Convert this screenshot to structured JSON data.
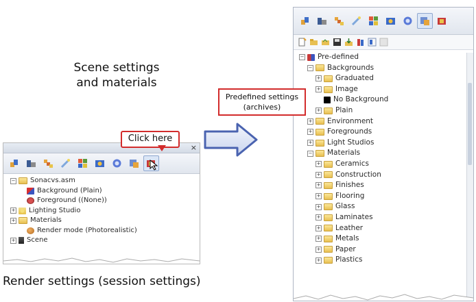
{
  "captions": {
    "scene": [
      "Scene settings",
      "and materials"
    ],
    "render": "Render settings (session settings)"
  },
  "callouts": {
    "click_here": "Click here",
    "predefined": [
      "Predefined settings",
      "(archives)"
    ]
  },
  "left_panel": {
    "close_label": "×",
    "tree": [
      {
        "label": "Sonacvs.asm",
        "level": 0,
        "expander": "−",
        "icon": "folder-icon"
      },
      {
        "label": "Background (Plain)",
        "level": 1,
        "expander": "",
        "icon": "background-icon"
      },
      {
        "label": "Foreground ((None))",
        "level": 1,
        "expander": "",
        "icon": "foreground-icon"
      },
      {
        "label": "Lighting Studio",
        "level": 1,
        "expander": "+",
        "icon": "lighting-icon"
      },
      {
        "label": "Materials",
        "level": 1,
        "expander": "+",
        "icon": "folder-icon"
      },
      {
        "label": "Render mode (Photorealistic)",
        "level": 1,
        "expander": "",
        "icon": "render-mode-icon"
      },
      {
        "label": "Scene",
        "level": 1,
        "expander": "+",
        "icon": "scene-icon"
      }
    ]
  },
  "right_panel": {
    "tree": [
      {
        "label": "Pre-defined",
        "level": 0,
        "expander": "−",
        "icon": "predefined-icon"
      },
      {
        "label": "Backgrounds",
        "level": 1,
        "expander": "−",
        "icon": "folder-icon"
      },
      {
        "label": "Graduated",
        "level": 2,
        "expander": "+",
        "icon": "folder-icon"
      },
      {
        "label": "Image",
        "level": 2,
        "expander": "+",
        "icon": "folder-icon"
      },
      {
        "label": "No Background",
        "level": 2,
        "expander": "",
        "icon": "black-square-icon"
      },
      {
        "label": "Plain",
        "level": 2,
        "expander": "+",
        "icon": "folder-icon"
      },
      {
        "label": "Environment",
        "level": 1,
        "expander": "+",
        "icon": "folder-icon"
      },
      {
        "label": "Foregrounds",
        "level": 1,
        "expander": "+",
        "icon": "folder-icon"
      },
      {
        "label": "Light Studios",
        "level": 1,
        "expander": "+",
        "icon": "folder-icon"
      },
      {
        "label": "Materials",
        "level": 1,
        "expander": "−",
        "icon": "folder-icon"
      },
      {
        "label": "Ceramics",
        "level": 2,
        "expander": "+",
        "icon": "folder-icon"
      },
      {
        "label": "Construction",
        "level": 2,
        "expander": "+",
        "icon": "folder-icon"
      },
      {
        "label": "Finishes",
        "level": 2,
        "expander": "+",
        "icon": "folder-icon"
      },
      {
        "label": "Flooring",
        "level": 2,
        "expander": "+",
        "icon": "folder-icon"
      },
      {
        "label": "Glass",
        "level": 2,
        "expander": "+",
        "icon": "folder-icon"
      },
      {
        "label": "Laminates",
        "level": 2,
        "expander": "+",
        "icon": "folder-icon"
      },
      {
        "label": "Leather",
        "level": 2,
        "expander": "+",
        "icon": "folder-icon"
      },
      {
        "label": "Metals",
        "level": 2,
        "expander": "+",
        "icon": "folder-icon"
      },
      {
        "label": "Paper",
        "level": 2,
        "expander": "+",
        "icon": "folder-icon"
      },
      {
        "label": "Plastics",
        "level": 2,
        "expander": "+",
        "icon": "folder-icon"
      }
    ]
  },
  "colors": {
    "callout_border": "#d22b2b",
    "arrow_fill": "#5b74b8",
    "folder": "#f0cf6a"
  }
}
